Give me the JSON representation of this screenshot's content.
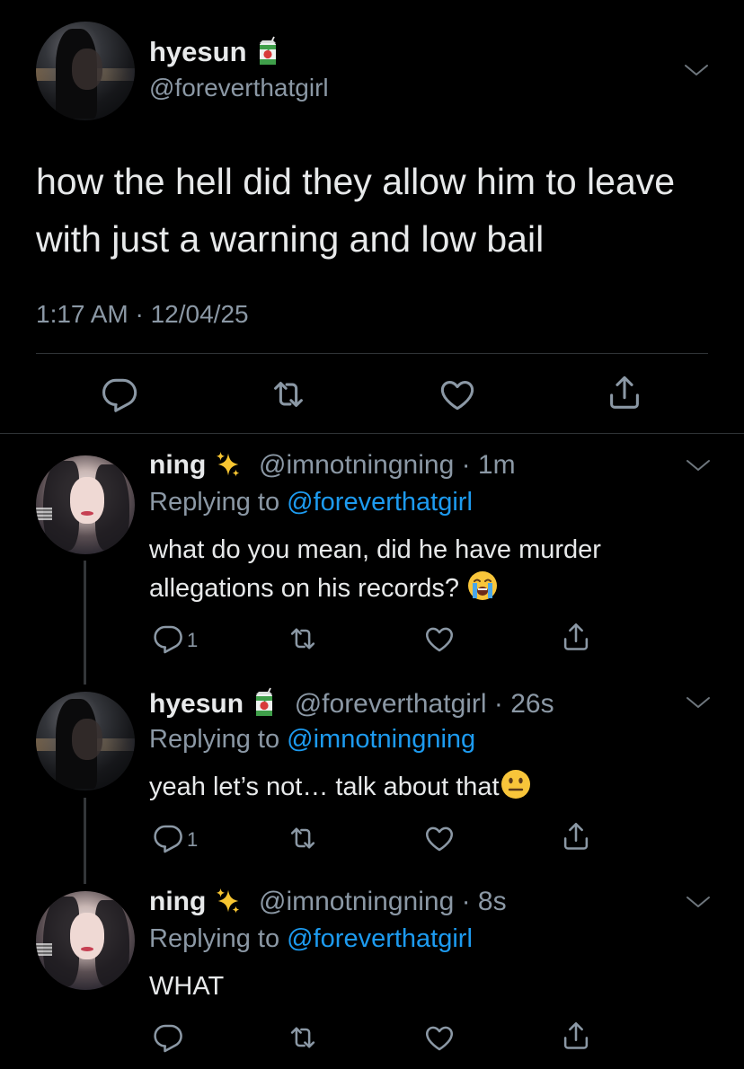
{
  "main_tweet": {
    "name": "hyesun",
    "name_emoji": "juice-box-emoji",
    "handle": "@foreverthatgirl",
    "text": "how the hell did they allow him to leave with just a warning and low bail",
    "time": "1:17 AM · 12/04/25"
  },
  "replies": [
    {
      "name": "ning",
      "name_emoji": "sparkles-emoji",
      "handle_time": "@imnotningning · 1m",
      "replying_prefix": "Replying to ",
      "replying_to": "@foreverthatgirl",
      "text": "what do you mean, did he have murder allegations on his records?",
      "text_emoji": "loudly-crying-face-emoji",
      "reply_count": "1"
    },
    {
      "name": "hyesun",
      "name_emoji": "juice-box-emoji",
      "handle_time": "@foreverthatgirl · 26s",
      "replying_prefix": "Replying to ",
      "replying_to": "@imnotningning",
      "text": "yeah let’s not… talk about that",
      "text_emoji": "neutral-face-emoji",
      "reply_count": "1"
    },
    {
      "name": "ning",
      "name_emoji": "sparkles-emoji",
      "handle_time": "@imnotningning · 8s",
      "replying_prefix": "Replying to ",
      "replying_to": "@foreverthatgirl",
      "text": "WHAT",
      "reply_count": ""
    }
  ],
  "colors": {
    "background": "#000000",
    "text": "#e7e9ea",
    "secondary": "#8b98a5",
    "link": "#1d9bf0",
    "divider": "#2f3336"
  }
}
